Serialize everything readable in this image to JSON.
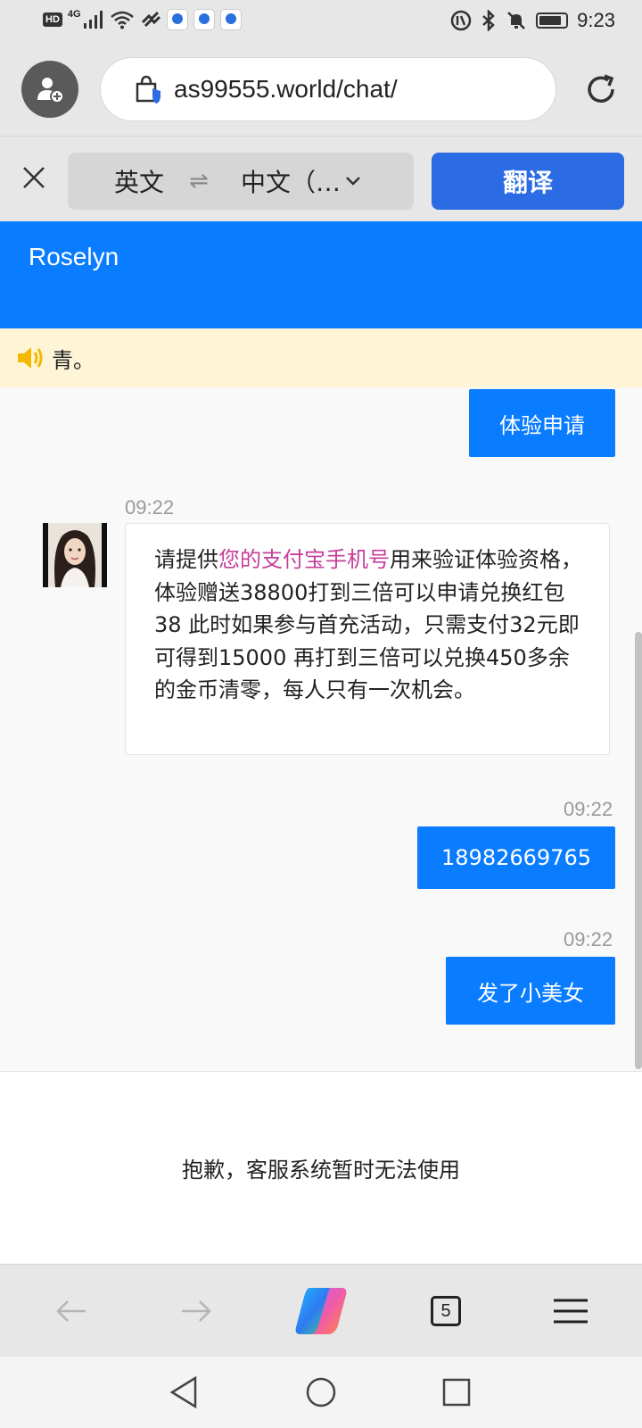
{
  "status_bar": {
    "network": "4G",
    "hd": "HD",
    "time": "9:23"
  },
  "browser": {
    "url": "as99555.world/chat/",
    "tab_count": "5"
  },
  "translate": {
    "source_lang": "英文",
    "target_lang": "中文（…",
    "button": "翻译"
  },
  "chat": {
    "agent_name": "Roselyn",
    "notice": "青。",
    "messages": [
      {
        "side": "out",
        "text": "体验申请"
      },
      {
        "side": "in",
        "time": "09:22",
        "text_before": "请提供",
        "text_highlight": "您的支付宝手机号",
        "text_after": "用来验证体验资格，体验赠送38800打到三倍可以申请兑换红包38 此时如果参与首充活动，只需支付32元即可得到15000 再打到三倍可以兑换450多余的金币清零，每人只有一次机会。"
      },
      {
        "side": "out",
        "time": "09:22",
        "text": "18982669765"
      },
      {
        "side": "out",
        "time": "09:22",
        "text": "发了小美女"
      }
    ],
    "closed_notice": "抱歉，客服系统暂时无法使用"
  },
  "colors": {
    "header_blue": "#0a7cff",
    "translate_blue": "#2b6be4",
    "highlight_pink": "#c43f9a",
    "notice_bg": "#fdf5d6"
  }
}
